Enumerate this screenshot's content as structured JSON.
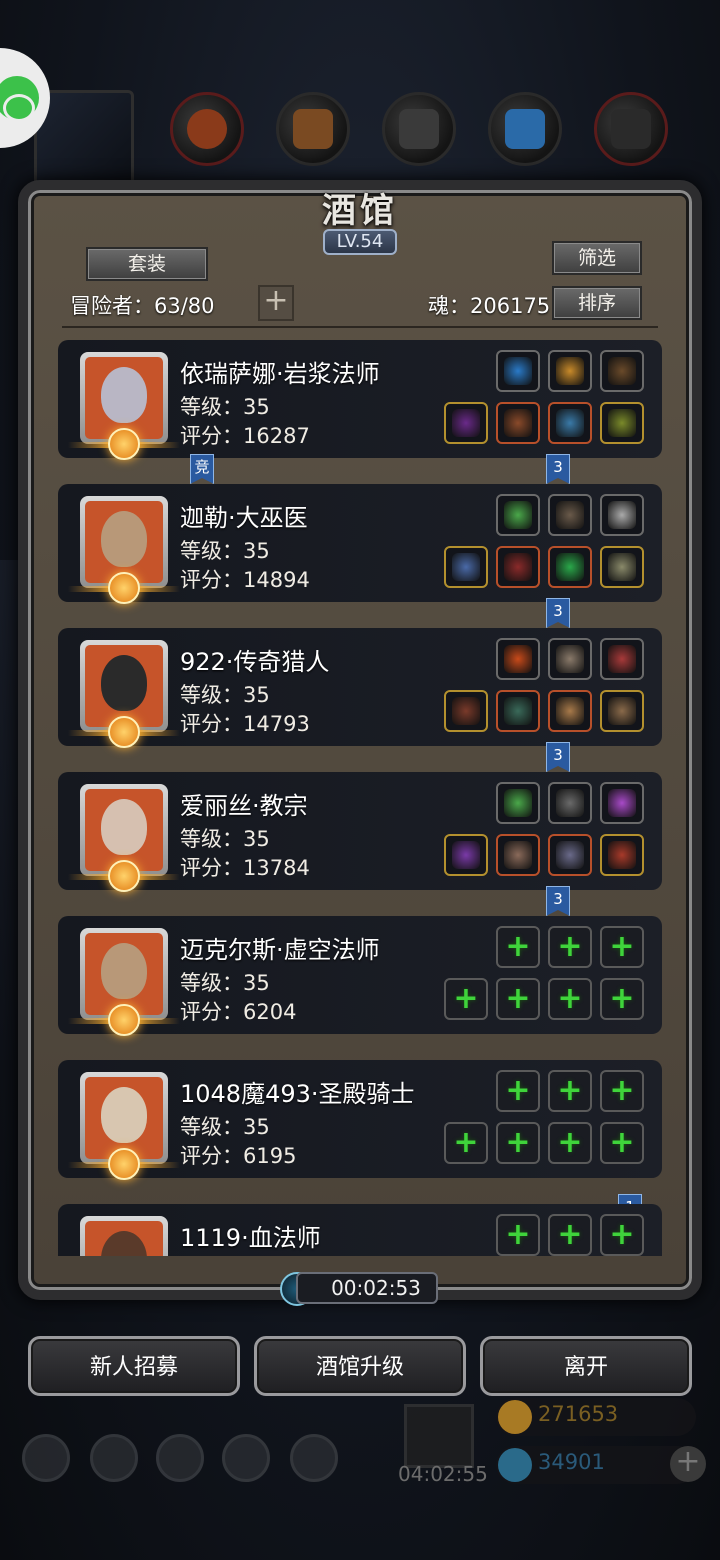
{
  "title": "酒馆",
  "level": "LV.54",
  "buttons": {
    "suit": "套装",
    "filter": "筛选",
    "sort": "排序",
    "recruit": "新人招募",
    "upgrade": "酒馆升级",
    "leave": "离开"
  },
  "adventurers": "冒险者：63/80",
  "soul": "魂：206175",
  "timer": "00:02:53",
  "hud": {
    "gold": "271653",
    "gems": "34901",
    "gift_timer": "04:02:55"
  },
  "heroes": [
    {
      "name": "依瑞萨娜·岩浆法师",
      "level": "等级：35",
      "score": "评分：16287",
      "tag": "竞",
      "tag2": "3",
      "equipped": true
    },
    {
      "name": "迦勒·大巫医",
      "level": "等级：35",
      "score": "评分：14894",
      "tag2": "3",
      "equipped": true
    },
    {
      "name": "922·传奇猎人",
      "level": "等级：35",
      "score": "评分：14793",
      "tag2": "3",
      "equipped": true
    },
    {
      "name": "爱丽丝·教宗",
      "level": "等级：35",
      "score": "评分：13784",
      "tag2": "3",
      "equipped": true
    },
    {
      "name": "迈克尔斯·虚空法师",
      "level": "等级：35",
      "score": "评分：6204",
      "equipped": false
    },
    {
      "name": "1048魔493·圣殿骑士",
      "level": "等级：35",
      "score": "评分：6195",
      "tag2": "1",
      "equipped": false
    },
    {
      "name": "1119·血法师",
      "equipped": false
    }
  ]
}
